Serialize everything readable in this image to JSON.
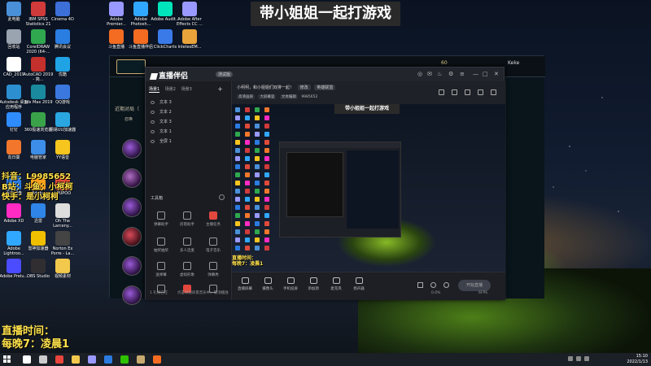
{
  "banner": {
    "text": "带小姐姐一起打游戏"
  },
  "desktop": {
    "icons": [
      {
        "label": "此电脑",
        "color": "#4a90d9"
      },
      {
        "label": "IBM SPSS Statistics 21",
        "color": "#d03a3a"
      },
      {
        "label": "Cinema 4D",
        "color": "#3d6fd8"
      },
      {
        "label": "回收站",
        "color": "#9aa4b0"
      },
      {
        "label": "CorelDRAW 2020 (64-...",
        "color": "#2fa84f"
      },
      {
        "label": "腾讯会议",
        "color": "#2a7de1"
      },
      {
        "label": "CAD_2019",
        "color": "#ffffff"
      },
      {
        "label": "AutoCAD 2019 - 简...",
        "color": "#c4302b"
      },
      {
        "label": "优酷",
        "color": "#1fa3e5"
      },
      {
        "label": "Autodesk 桌面应用程序",
        "color": "#2b8fd0"
      },
      {
        "label": "3ds Max 2019",
        "color": "#1a8a9e"
      },
      {
        "label": "QQ游戏",
        "color": "#3a78e0"
      },
      {
        "label": "钉钉",
        "color": "#2f8cff"
      },
      {
        "label": "360极速浏览器",
        "color": "#3aa34a"
      },
      {
        "label": "网易UU加速器",
        "color": "#2aa7e0"
      },
      {
        "label": "向日葵",
        "color": "#f2772c"
      },
      {
        "label": "电脑管家",
        "color": "#3c8ee8"
      },
      {
        "label": "YY语音",
        "color": "#f6c51e"
      },
      {
        "label": "百度网盘",
        "color": "#2b7be0"
      },
      {
        "label": "Adobe Illustrat...",
        "color": "#f7a01c"
      },
      {
        "label": "LPUPOO",
        "color": "#e04a3a"
      },
      {
        "label": "Adobe XD",
        "color": "#ff2bc2"
      },
      {
        "label": "迅雷",
        "color": "#2f86e8"
      },
      {
        "label": "Oh The Larceny...",
        "color": "#dddddd"
      },
      {
        "label": "Adobe Lightroo...",
        "color": "#31a8ff"
      },
      {
        "label": "雷神加速器",
        "color": "#f0c000"
      },
      {
        "label": "Norton Ex Porre - La...",
        "color": "#444444"
      },
      {
        "label": "Adobe Prelu...",
        "color": "#4b4bff"
      },
      {
        "label": "OBS Studio",
        "color": "#302e31"
      },
      {
        "label": "视频素材",
        "color": "#f2c94c"
      },
      {
        "label": "Adobe Premier...",
        "color": "#9999ff"
      },
      {
        "label": "Adobe Photosh...",
        "color": "#31a8ff"
      },
      {
        "label": "Adobe Audit...",
        "color": "#00e4bb"
      },
      {
        "label": "Adobe After Effects CC ...",
        "color": "#9999ff"
      },
      {
        "label": "斗鱼直播",
        "color": "#f36c21"
      },
      {
        "label": "斗鱼直播伴侣",
        "color": "#f36c21"
      },
      {
        "label": "ClickCharts",
        "color": "#3a7ae8"
      },
      {
        "label": "InletesEM...",
        "color": "#e8a33a"
      }
    ]
  },
  "overlay": {
    "douyin": "抖音：L9985652",
    "bilibili": "B站：斗鱼：小柯柯",
    "kuaishou": "快手：是小柯柯",
    "live_time_label": "直播时间：",
    "live_time_value": "每晚7：凌晨1"
  },
  "lol": {
    "username": "Keke",
    "coins": "60",
    "recent_label": "近期对局（",
    "lobby_label": "召唤",
    "levels": [
      "14",
      "14",
      "14",
      "14",
      "17",
      "14"
    ]
  },
  "app": {
    "title": "直播伴侣",
    "badge": "测试版",
    "tabs": [
      "场景1",
      "场景2",
      "场景3"
    ],
    "sources": [
      "文本 3",
      "文本 2",
      "文本 3",
      "文本 1",
      "全屏 1"
    ],
    "toolbox_label": "工具箱",
    "tools": [
      "弹幕助手",
      "房管助手",
      "主播任务",
      "抽奖抽奖",
      "多人连麦",
      "电子音乐",
      "送弹幕",
      "虚拟形象",
      "弹幕秀",
      "礼物秀",
      "直播PK",
      "连麦"
    ],
    "room_title": "小柯柯，和小姐姐们双排一起！",
    "room_edit": "修改",
    "room_category": "英雄联盟",
    "room_id": "9985652",
    "room_sub_chips": [
      "高清画质",
      "大屏幕竖",
      "文本编辑"
    ],
    "preview_banner": "带小姐姐一起打游戏",
    "preview_overlay_1": "直播时间：",
    "preview_overlay_2": "每晚7：凌晨1",
    "bottom_tools": [
      "直播屏幕",
      "摄像头",
      "手机投屏",
      "添加源",
      "麦克风",
      "扬声器"
    ],
    "go_live": "开始直播",
    "status": [
      "1 礼物已在",
      "点击添加背景音乐中，取消播放",
      "0.0%",
      "6FPS"
    ]
  },
  "taskbar": {
    "time": "15:10",
    "date": "2022/1/13",
    "icons": [
      {
        "name": "search-icon",
        "color": "#ffffff"
      },
      {
        "name": "taskview-icon",
        "color": "#cccccc"
      },
      {
        "name": "chrome-icon",
        "color": "#e8453c"
      },
      {
        "name": "folder-icon",
        "color": "#f2c94c"
      },
      {
        "name": "premiere-icon",
        "color": "#9999ff"
      },
      {
        "name": "mail-icon",
        "color": "#2b7be0"
      },
      {
        "name": "wechat-icon",
        "color": "#2dc100"
      },
      {
        "name": "lol-icon",
        "color": "#c8aa6e"
      },
      {
        "name": "douyu-icon",
        "color": "#f36c21"
      }
    ]
  }
}
